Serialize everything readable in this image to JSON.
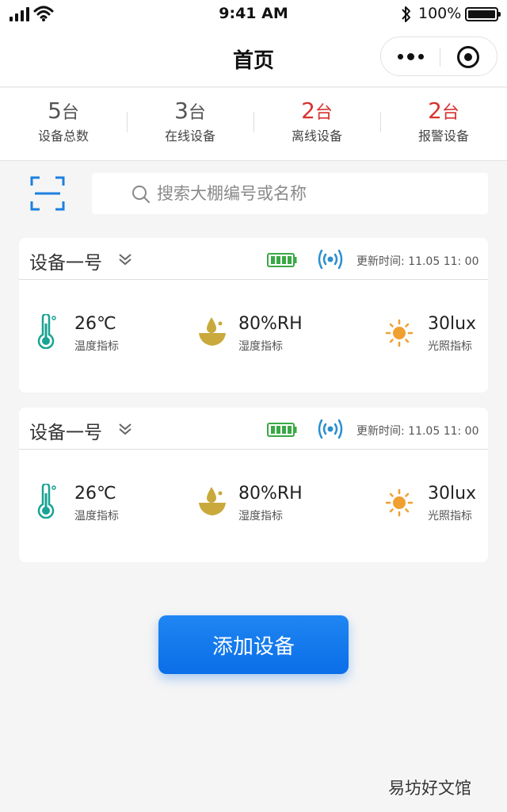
{
  "status_bar": {
    "time": "9:41 AM",
    "battery_pct": "100%"
  },
  "nav": {
    "title": "首页"
  },
  "stats": [
    {
      "value": "5",
      "unit": "台",
      "label": "设备总数",
      "alert": false
    },
    {
      "value": "3",
      "unit": "台",
      "label": "在线设备",
      "alert": false
    },
    {
      "value": "2",
      "unit": "台",
      "label": "离线设备",
      "alert": true
    },
    {
      "value": "2",
      "unit": "台",
      "label": "报警设备",
      "alert": true
    }
  ],
  "search": {
    "placeholder": "搜索大棚编号或名称",
    "value": ""
  },
  "devices": [
    {
      "name": "设备一号",
      "update_time": "更新时间: 11.05 11: 00",
      "metrics": {
        "temperature": {
          "value": "26℃",
          "label": "温度指标"
        },
        "humidity": {
          "value": "80%RH",
          "label": "湿度指标"
        },
        "light": {
          "value": "30lux",
          "label": "光照指标"
        }
      }
    },
    {
      "name": "设备一号",
      "update_time": "更新时间: 11.05 11: 00",
      "metrics": {
        "temperature": {
          "value": "26℃",
          "label": "温度指标"
        },
        "humidity": {
          "value": "80%RH",
          "label": "湿度指标"
        },
        "light": {
          "value": "30lux",
          "label": "光照指标"
        }
      }
    }
  ],
  "add_button": {
    "label": "添加设备"
  },
  "watermark": "易坊好文馆",
  "colors": {
    "primary": "#0a6ee8",
    "alert": "#d7322e",
    "battery": "#3aa845",
    "signal": "#2a8fd0",
    "thermometer": "#1aa394",
    "humidity": "#c9a93b",
    "sun": "#f0a030",
    "scan": "#1d7fe0"
  }
}
